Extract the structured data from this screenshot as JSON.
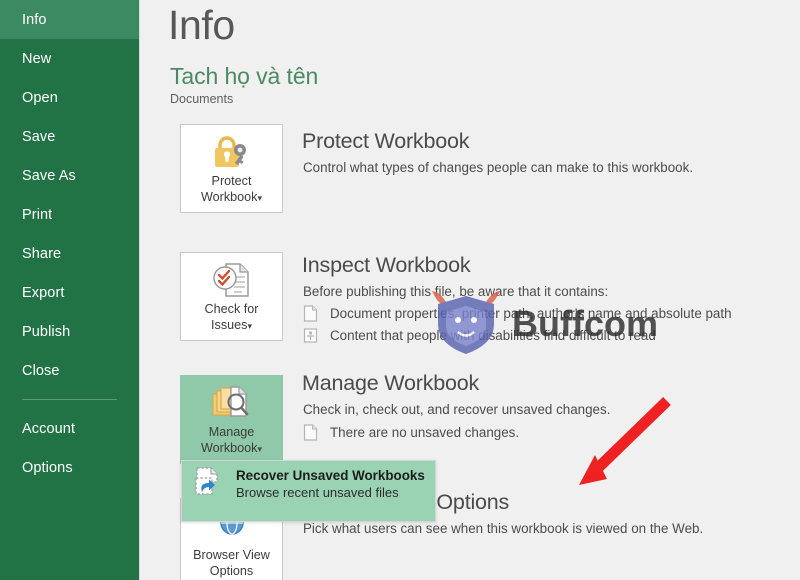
{
  "sidebar": {
    "items": [
      {
        "label": "Info",
        "active": true
      },
      {
        "label": "New",
        "active": false
      },
      {
        "label": "Open",
        "active": false
      },
      {
        "label": "Save",
        "active": false
      },
      {
        "label": "Save As",
        "active": false
      },
      {
        "label": "Print",
        "active": false
      },
      {
        "label": "Share",
        "active": false
      },
      {
        "label": "Export",
        "active": false
      },
      {
        "label": "Publish",
        "active": false
      },
      {
        "label": "Close",
        "active": false
      },
      {
        "label": "Account",
        "active": false
      },
      {
        "label": "Options",
        "active": false
      }
    ]
  },
  "header": {
    "title": "Info",
    "file_name": "Tach họ và tên",
    "file_path": "Documents"
  },
  "sections": {
    "protect": {
      "button_label_line1": "Protect",
      "button_label_line2": "Workbook",
      "caret": "▾",
      "heading": "Protect Workbook",
      "description": "Control what types of changes people can make to this workbook.",
      "icon": "padlock-key-icon"
    },
    "inspect": {
      "button_label_line1": "Check for",
      "button_label_line2": "Issues",
      "caret": "▾",
      "heading": "Inspect Workbook",
      "description": "Before publishing this file, be aware that it contains:",
      "bullets": [
        "Document properties, printer path, author's name and absolute path",
        "Content that people with disabilities find difficult to read"
      ],
      "icon": "document-checklist-icon"
    },
    "manage": {
      "button_label_line1": "Manage",
      "button_label_line2": "Workbook",
      "caret": "▾",
      "heading": "Manage Workbook",
      "description": "Check in, check out, and recover unsaved changes.",
      "bullets": [
        "There are no unsaved changes."
      ],
      "icon": "documents-magnifier-icon",
      "highlighted": true
    },
    "browser_view": {
      "button_label_line1": "Browser View",
      "button_label_line2": "Options",
      "heading": "Browser View Options",
      "description": "Pick what users can see when this workbook is viewed on the Web.",
      "icon": "globe-icon"
    }
  },
  "dropdown": {
    "title": "Recover Unsaved Workbooks",
    "subtitle": "Browse recent unsaved files",
    "icon": "recover-document-icon"
  },
  "watermark": {
    "text": "Buffcom",
    "icon": "buffalo-shield-logo"
  },
  "annotation": {
    "type": "arrow",
    "color": "#ee2222",
    "points_to": "recover-unsaved-workbooks"
  },
  "colors": {
    "sidebar_bg": "#217346",
    "sidebar_active": "#3c8a62",
    "main_bg": "#f0f0f0",
    "accent_green": "#4a8a62",
    "highlight_green": "#8fc9a9",
    "dropdown_green": "#9ad3b4",
    "arrow_red": "#ee2222"
  }
}
